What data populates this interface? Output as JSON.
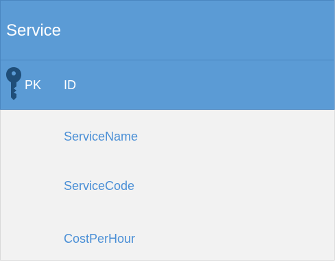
{
  "entity": {
    "name": "Service",
    "primary_key": {
      "marker": "PK",
      "field": "ID"
    },
    "attributes": [
      {
        "name": "ServiceName"
      },
      {
        "name": "ServiceCode"
      },
      {
        "name": "CostPerHour"
      }
    ]
  },
  "colors": {
    "header_bg": "#5b9bd5",
    "key_icon": "#1f4e79",
    "body_bg": "#f2f2f2",
    "attribute_text": "#4a8fd6"
  },
  "icons": {
    "key": "key-icon"
  }
}
